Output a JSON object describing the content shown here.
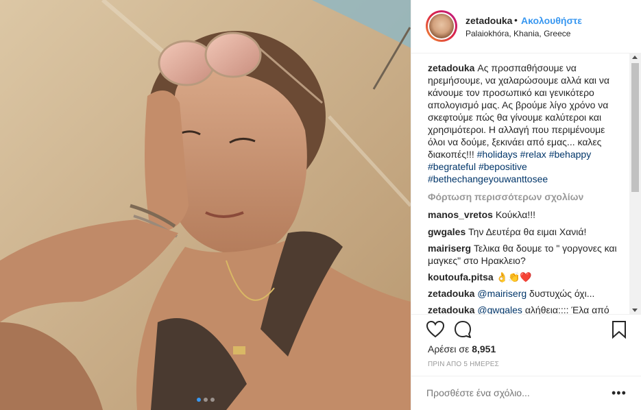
{
  "post": {
    "carousel": {
      "count": 3,
      "active": 0
    }
  },
  "header": {
    "username": "zetadouka",
    "separator": "•",
    "follow_label": "Ακολουθήστε",
    "location": "Palaiokhóra, Khania, Greece"
  },
  "caption": {
    "username": "zetadouka",
    "text": "Ας προσπαθήσουμε να ηρεμήσουμε, να χαλαρώσουμε αλλά και να κάνουμε τον προσωπικό και γενικότερο απολογισμό μας. Ας βρούμε λίγο χρόνο να σκεφτούμε πώς θα γίνουμε καλύτεροι και χρησιμότεροι. Η αλλαγή που περιμένουμε όλοι να δούμε, ξεκινάει από εμας... καλες διακοπές!!!",
    "hashtags": [
      "#holidays",
      "#relax",
      "#behappy",
      "#begrateful",
      "#bepositive",
      "#bethechangeyouwanttosee"
    ]
  },
  "load_more": "Φόρτωση περισσότερων σχολίων",
  "comments": [
    {
      "username": "manos_vretos",
      "text": "Κούκλα!!!"
    },
    {
      "username": "gwgales",
      "text": "Την Δευτέρα θα ειμαι Χανιά!"
    },
    {
      "username": "mairiserg",
      "text": "Τελικα θα δουμε το \" γοργονες και μαγκες\" στο Ηρακλειο?"
    },
    {
      "username": "koutoufa.pitsa",
      "text": "👌👏❤️"
    },
    {
      "username": "zetadouka",
      "mention": "@mairiserg",
      "text": "δυστυχώς όχι..."
    },
    {
      "username": "zetadouka",
      "mention": "@gwgales",
      "text": "αλήθεια:::: Έλα από"
    }
  ],
  "likes": {
    "prefix": "Αρέσει σε",
    "count": "8,951"
  },
  "timestamp": "ΠΡΙΝ ΑΠΟ 5 ΗΜΕΡΕΣ",
  "add_comment": {
    "placeholder": "Προσθέστε ένα σχόλιο..."
  },
  "more_label": "•••",
  "icons": [
    "heart-icon",
    "comment-icon",
    "bookmark-icon"
  ],
  "colors": {
    "link": "#3897f0",
    "hashtag": "#003569",
    "muted": "#999999",
    "like_red": "#ed4956"
  }
}
